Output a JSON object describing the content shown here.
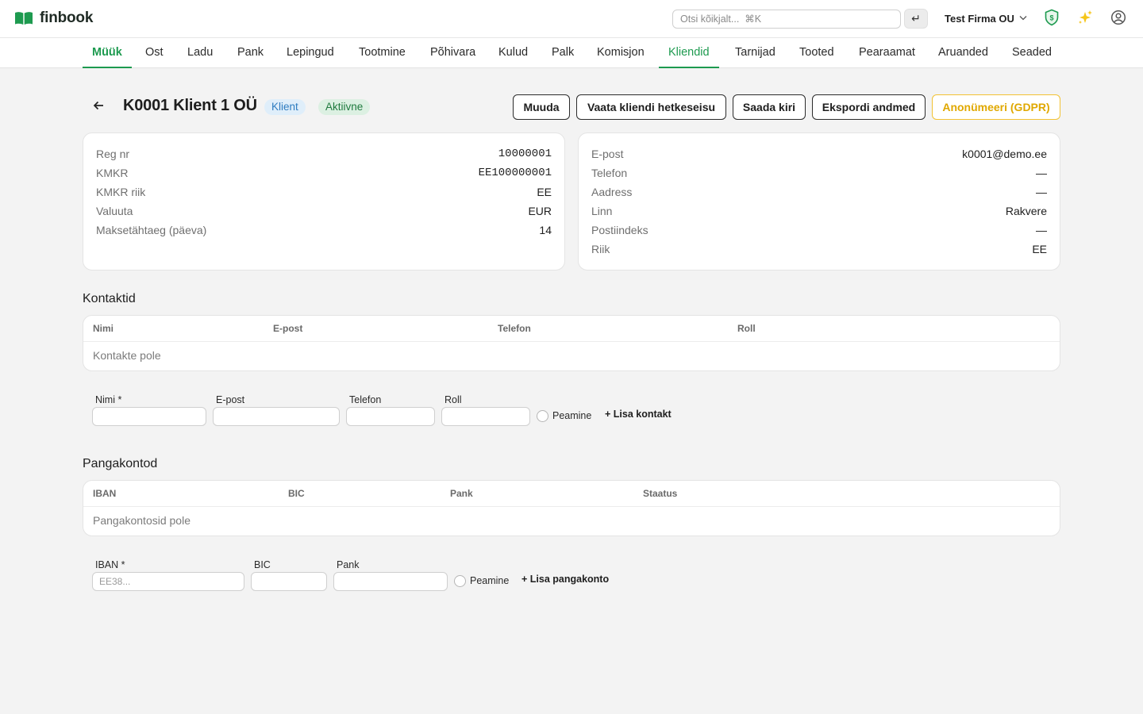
{
  "app": {
    "name": "finbook"
  },
  "search": {
    "placeholder": "Otsi kõikjalt...  ⌘K",
    "submit_icon": "↵"
  },
  "company": {
    "name": "Test Firma OU"
  },
  "nav": {
    "items": [
      "Müük",
      "Ost",
      "Ladu",
      "Pank",
      "Lepingud",
      "Tootmine",
      "Põhivara",
      "Kulud",
      "Palk",
      "Komisjon",
      "Kliendid",
      "Tarnijad",
      "Tooted",
      "Pearaamat",
      "Aruanded",
      "Seaded"
    ],
    "active": [
      "Müük",
      "Kliendid"
    ]
  },
  "client": {
    "title": "K0001 Klient 1 OÜ",
    "badge_type": "Klient",
    "badge_status": "Aktiivne"
  },
  "actions": {
    "edit": "Muuda",
    "statement": "Vaata kliendi hetkeseisu",
    "send_letter": "Saada kiri",
    "export": "Ekspordi andmed",
    "anonymize": "Anonümeeri (GDPR)"
  },
  "details_left": [
    {
      "label": "Reg nr",
      "value": "10000001"
    },
    {
      "label": "KMKR",
      "value": "EE100000001"
    },
    {
      "label": "KMKR riik",
      "value": "EE"
    },
    {
      "label": "Valuuta",
      "value": "EUR"
    },
    {
      "label": "Maksetähtaeg (päeva)",
      "value": "14"
    }
  ],
  "details_right": [
    {
      "label": "E-post",
      "value": "k0001@demo.ee"
    },
    {
      "label": "Telefon",
      "value": "—"
    },
    {
      "label": "Aadress",
      "value": "—"
    },
    {
      "label": "Linn",
      "value": "Rakvere"
    },
    {
      "label": "Postiindeks",
      "value": "—"
    },
    {
      "label": "Riik",
      "value": "EE"
    }
  ],
  "contacts": {
    "title": "Kontaktid",
    "columns": [
      "Nimi",
      "E-post",
      "Telefon",
      "Roll"
    ],
    "empty": "Kontakte pole",
    "form": {
      "name_label": "Nimi *",
      "email_label": "E-post",
      "phone_label": "Telefon",
      "role_label": "Roll",
      "primary_label": "Peamine",
      "add": "+ Lisa kontakt"
    }
  },
  "bank_accounts": {
    "title": "Pangakontod",
    "columns": [
      "IBAN",
      "BIC",
      "Pank",
      "Staatus"
    ],
    "empty": "Pangakontosid pole",
    "form": {
      "iban_label": "IBAN *",
      "iban_placeholder": "EE38...",
      "bic_label": "BIC",
      "bank_label": "Pank",
      "primary_label": "Peamine",
      "add": "+ Lisa pangakonto"
    }
  },
  "colors": {
    "brand": "#1d9a4f",
    "warning": "#f2c233",
    "info": "#2e7cc0"
  }
}
